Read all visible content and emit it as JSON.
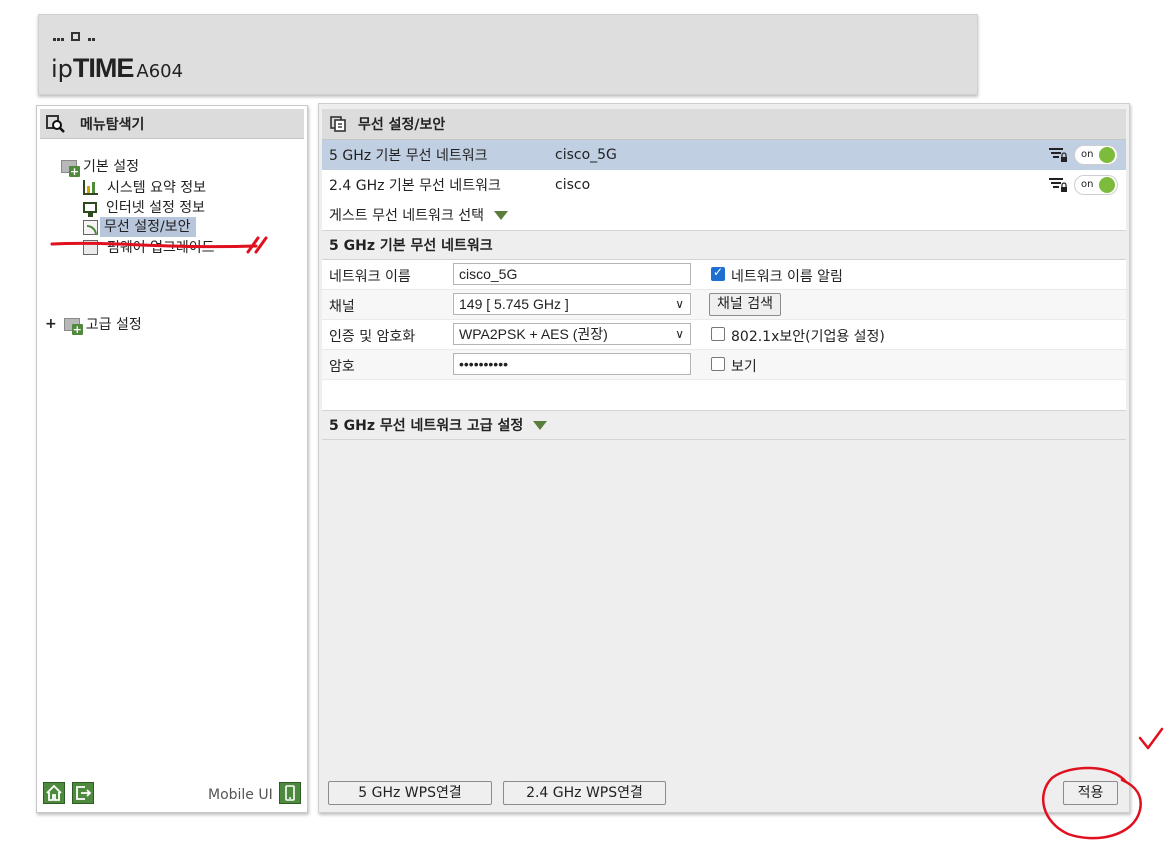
{
  "header": {
    "brand_ip": "ip",
    "brand_time": "TIME",
    "brand_model": "A604"
  },
  "sidebar": {
    "title": "메뉴탐색기",
    "items": [
      {
        "label": "기본 설정"
      },
      {
        "label": "시스템 요약 정보"
      },
      {
        "label": "인터넷 설정 정보"
      },
      {
        "label": "무선 설정/보안",
        "selected": true
      },
      {
        "label": "펌웨어 업그레이드"
      },
      {
        "label": "고급 설정"
      }
    ],
    "advanced_plus": "+",
    "mobile_ui": "Mobile UI",
    "footer_icons": [
      "home-icon",
      "logout-icon",
      "mobile-icon"
    ]
  },
  "main": {
    "title": "무선 설정/보안",
    "networks": [
      {
        "name": "5 GHz 기본 무선 네트워크",
        "ssid": "cisco_5G",
        "toggle": "on",
        "highlighted": true
      },
      {
        "name": "2.4 GHz 기본 무선 네트워크",
        "ssid": "cisco",
        "toggle": "on",
        "highlighted": false
      }
    ],
    "guest_label": "게스트 무선 네트워크 선택",
    "section_title": "5 GHz 기본 무선 네트워크",
    "form": {
      "network_name_label": "네트워크 이름",
      "network_name_value": "cisco_5G",
      "broadcast_label": "네트워크 이름 알림",
      "broadcast_checked": true,
      "channel_label": "채널",
      "channel_value": "149 [ 5.745 GHz ]",
      "channel_search": "채널 검색",
      "auth_label": "인증 및 암호화",
      "auth_value": "WPA2PSK + AES (권장)",
      "dot1x_label": "802.1x보안(기업용 설정)",
      "dot1x_checked": false,
      "password_label": "암호",
      "password_value": "••••••••••",
      "show_label": "보기",
      "show_checked": false
    },
    "advanced_title": "5 GHz 무선 네트워크 고급 설정",
    "buttons": {
      "wps5": "5 GHz WPS연결",
      "wps24": "2.4 GHz WPS연결",
      "apply": "적용"
    }
  },
  "colors": {
    "accent_green": "#4e8a3d",
    "selected_row": "#b8c6dc",
    "annotation_red": "#e0101e"
  }
}
